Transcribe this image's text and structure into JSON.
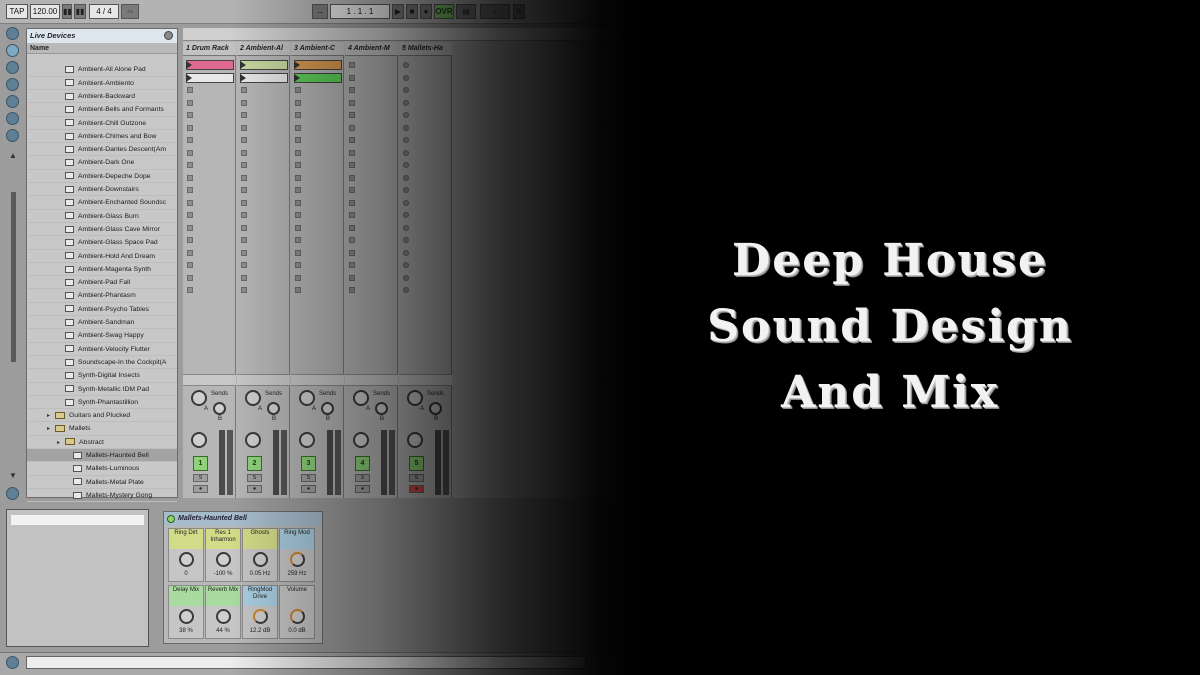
{
  "toolbar": {
    "tap": "TAP",
    "tempo": "120.00",
    "signature_num": "4",
    "signature_slash": "/",
    "signature_den": "4",
    "position": "1 . 1 . 1",
    "ovr": "OVR"
  },
  "browser": {
    "title": "Live Devices",
    "column": "Name",
    "items": [
      "Ambient-All Alone Pad",
      "Ambient-Ambiento",
      "Ambient-Backward",
      "Ambient-Bells and Formants",
      "Ambient-Chill Outzone",
      "Ambient-Chimes and Bow",
      "Ambient-Dantes Descent(Am",
      "Ambient-Dark One",
      "Ambient-Depeche Dope",
      "Ambient-Downstairs",
      "Ambient-Enchanted Soundsc",
      "Ambient-Glass Burn",
      "Ambient-Glass Cave Mirror",
      "Ambient-Glass Space Pad",
      "Ambient-Hold And Dream",
      "Ambient-Magenta Synth",
      "Ambient-Pad Fall",
      "Ambient-Phantasm",
      "Ambient-Psycho Tables",
      "Ambient-Sandman",
      "Ambient-Swag Happy",
      "Ambient-Velocity Flutter",
      "Soundscape-In the Cockpit(A",
      "Synth-Digital Insects",
      "Synth-Metallic IDM Pad",
      "Synth-Phantastillion"
    ],
    "folders": [
      "Guitars and Plucked",
      "Mallets",
      "Abstract"
    ],
    "sub_items": [
      "Mallets-Haunted Bell",
      "Mallets-Luminous",
      "Mallets-Metal Plate",
      "Mallets-Mystery Gong"
    ]
  },
  "session": {
    "tracks": [
      {
        "name": "1 Drum Rack",
        "num": "1"
      },
      {
        "name": "2 Ambient-Al",
        "num": "2"
      },
      {
        "name": "3 Ambient-C",
        "num": "3"
      },
      {
        "name": "4 Ambient-M",
        "num": "4"
      },
      {
        "name": "5 Mallets-Ha",
        "num": "5"
      }
    ],
    "sends_label": "Sends",
    "send_a": "A",
    "send_b": "B",
    "solo": "S",
    "record": "●",
    "clip_colors": [
      "#e0698f",
      "#c9d8a0",
      "#d99a52",
      "#5fcf5a"
    ]
  },
  "device": {
    "title": "Mallets-Haunted Bell",
    "macros": [
      {
        "name": "Ring Dirt",
        "value": "0",
        "color": "#d2dc88"
      },
      {
        "name": "Res 1 Inharmon",
        "value": "-100 %",
        "color": "#d2dc88"
      },
      {
        "name": "Ghosts",
        "value": "0.05 Hz",
        "color": "#d2dc88"
      },
      {
        "name": "Ring Mod",
        "value": "259 Hz",
        "color": "#a9cde0"
      },
      {
        "name": "Delay Mix",
        "value": "38 %",
        "color": "#a9dba0"
      },
      {
        "name": "Reverb Mix",
        "value": "44 %",
        "color": "#a9dba0"
      },
      {
        "name": "RingMod Drive",
        "value": "12.2 dB",
        "color": "#a9cde0"
      },
      {
        "name": "Volume",
        "value": "0.0 dB",
        "color": "#c6c6c6"
      }
    ]
  },
  "headline": {
    "line1": "Deep House",
    "line2": "Sound Design",
    "line3": "And Mix"
  }
}
